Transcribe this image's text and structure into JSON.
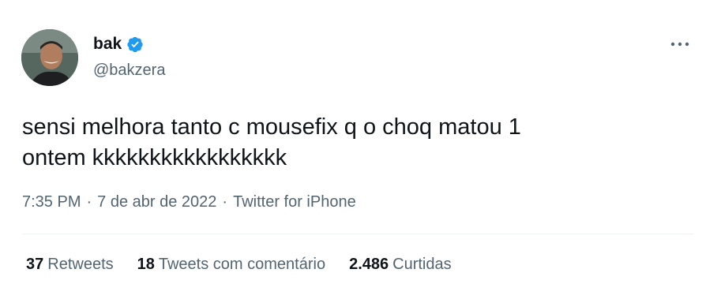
{
  "author": {
    "display_name": "bak",
    "handle": "@bakzera",
    "verified_icon": "verified-badge-icon",
    "verified_color": "#1d9bf0"
  },
  "tweet": {
    "text": "sensi melhora tanto c mousefix q o choq matou 1\nontem kkkkkkkkkkkkkkkkk"
  },
  "meta": {
    "time": "7:35 PM",
    "date": "7 de abr de 2022",
    "source": "Twitter for iPhone",
    "separator": "·"
  },
  "stats": {
    "retweets_count": "37",
    "retweets_label": "Retweets",
    "quotes_count": "18",
    "quotes_label": "Tweets com comentário",
    "likes_count": "2.486",
    "likes_label": "Curtidas"
  },
  "colors": {
    "text_primary": "#0f1419",
    "text_secondary": "#536471",
    "divider": "#eff3f4"
  }
}
